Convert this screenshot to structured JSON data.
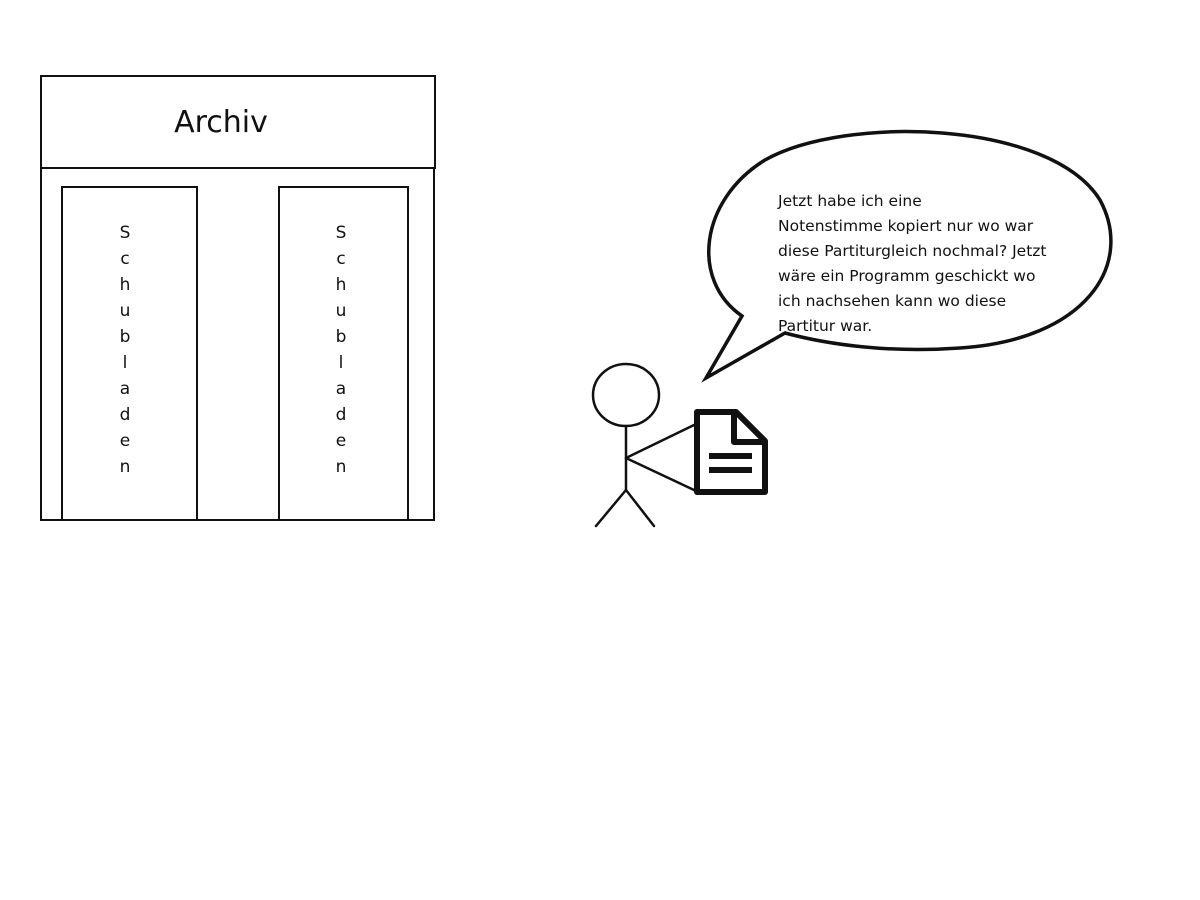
{
  "archive": {
    "title": "Archiv",
    "drawers": [
      {
        "label": "Schubladen"
      },
      {
        "label": "Schubladen"
      }
    ]
  },
  "speech": {
    "lines": [
      "Jetzt habe ich eine",
      "Notenstimme kopiert nur wo war",
      "diese Partiturgleich nochmal? Jetzt",
      "wäre ein  Programm geschickt wo",
      "ich nachsehen kann wo diese",
      "Partitur war."
    ]
  },
  "colors": {
    "ink": "#111111",
    "background": "#ffffff"
  }
}
